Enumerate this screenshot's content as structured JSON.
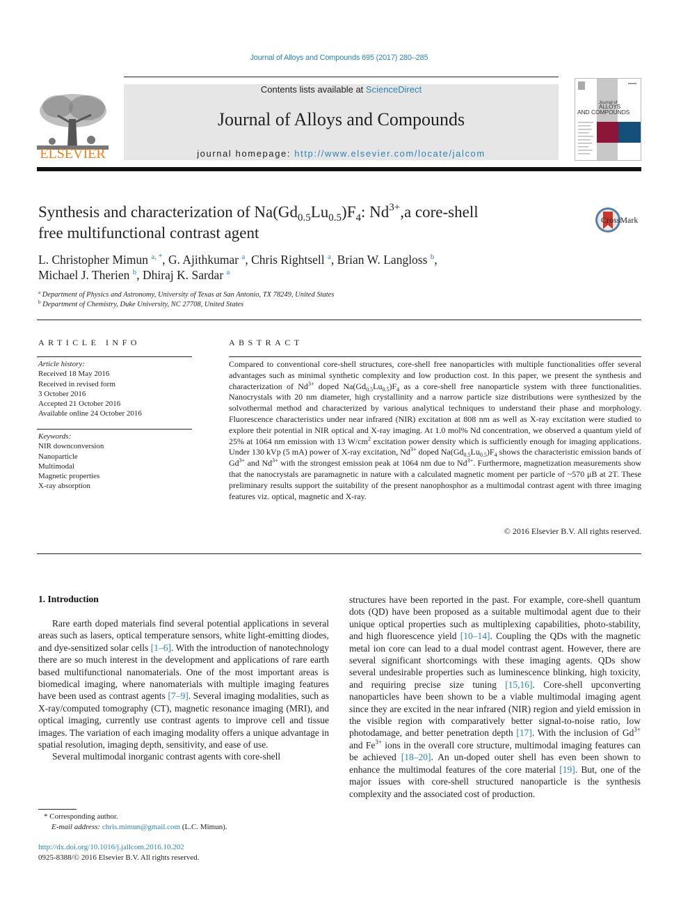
{
  "header": {
    "citation": "Journal of Alloys and Compounds 695 (2017) 280–285",
    "contents_prefix": "Contents lists available at ",
    "contents_link": "ScienceDirect",
    "journal_name": "Journal of Alloys and Compounds",
    "homepage_prefix": "journal homepage: ",
    "homepage_url": "http://www.elsevier.com/locate/jalcom",
    "publisher_logo_text": "ELSEVIER",
    "cover": {
      "title_line1": "Journal of",
      "title_line2": "ALLOYS",
      "title_line3": "AND COMPOUNDS",
      "accent_colors": [
        "#8c1538",
        "#15507a",
        "#c8c8c8"
      ]
    },
    "crossmark_label": "CrossMark"
  },
  "article": {
    "title_parts": {
      "p1": "Synthesis and characterization of Na(Gd",
      "s1": "0.5",
      "p2": "Lu",
      "s2": "0.5",
      "p3": ")F",
      "s3": "4",
      "p4": ": Nd",
      "sup1": "3+",
      "p5": ",a core-shell",
      "line2": "free multifunctional contrast agent"
    },
    "authors": [
      {
        "name": "L. Christopher Mimun",
        "aff": "a, *"
      },
      {
        "name": "G. Ajithkumar",
        "aff": "a"
      },
      {
        "name": "Chris Rightsell",
        "aff": "a"
      },
      {
        "name": "Brian W. Langloss",
        "aff": "b"
      },
      {
        "name": "Michael J. Therien",
        "aff": "b"
      },
      {
        "name": "Dhiraj K. Sardar",
        "aff": "a"
      }
    ],
    "affiliations": [
      {
        "key": "a",
        "text": "Department of Physics and Astronomy, University of Texas at San Antonio, TX 78249, United States"
      },
      {
        "key": "b",
        "text": "Department of Chemistry, Duke University, NC 27708, United States"
      }
    ]
  },
  "article_info": {
    "heading": "ARTICLE INFO",
    "history_heading": "Article history:",
    "history": [
      "Received 18 May 2016",
      "Received in revised form",
      "3 October 2016",
      "Accepted 21 October 2016",
      "Available online 24 October 2016"
    ],
    "keywords_heading": "Keywords:",
    "keywords": [
      "NIR downconversion",
      "Nanoparticle",
      "Multimodal",
      "Magnetic properties",
      "X-ray absorption"
    ]
  },
  "abstract": {
    "heading": "ABSTRACT",
    "t1": "Compared to conventional core-shell structures, core-shell free nanoparticles with multiple functionalities offer several advantages such as minimal synthetic complexity and low production cost. In this paper, we present the synthesis and characterization of Nd",
    "t2": " doped Na(Gd",
    "t3": "Lu",
    "t4": ")F",
    "t5": " as a core-shell free nanoparticle system with three functionalities. Nanocrystals with 20 nm diameter, high crystallinity and a narrow particle size distributions were synthesized by the solvothermal method and characterized by various analytical techniques to understand their phase and morphology. Fluorescence characteristics under near infrared (NIR) excitation at 808 nm as well as X-ray excitation were studied to explore their potential in NIR optical and X-ray imaging. At 1.0 mol% Nd concentration, we observed a quantum yield of 25% at 1064 nm emission with 13 W/cm",
    "t6": " excitation power density which is sufficiently enough for imaging applications. Under 130 kVp (5 mA) power of X-ray excitation, Nd",
    "t7": " doped Na(Gd",
    "t8": "Lu",
    "t9": ")F",
    "t10": " shows the characteristic emission bands of Gd",
    "t11": " and Nd",
    "t12": " with the strongest emission peak at 1064 nm due to Nd",
    "t13": ". Furthermore, magnetization measurements show that the nanocrystals are paramagnetic in nature with a calculated magnetic moment per particle of ~570 μB at 2T. These preliminary results support the suitability of the present nanophosphor as a multimodal contrast agent with three imaging features viz. optical, magnetic and X-ray.",
    "sup_3plus": "3+",
    "sub_05": "0.5",
    "sub_4": "4",
    "sup_2": "2",
    "copyright": "© 2016 Elsevier B.V. All rights reserved."
  },
  "introduction": {
    "heading": "1.  Introduction",
    "left_p1_a": "Rare earth doped materials find several potential applications in several areas such as lasers, optical temperature sensors, white light-emitting diodes, and dye-sensitized solar cells ",
    "left_p1_ref1": "[1–6]",
    "left_p1_b": ". With the introduction of nanotechnology there are so much interest in the development and applications of rare earth based multifunctional nanomaterials. One of the most important areas is biomedical imaging, where nanomaterials with multiple imaging features have been used as contrast agents ",
    "left_p1_ref2": "[7–9]",
    "left_p1_c": ". Several imaging modalities, such as X-ray/computed tomography (CT), magnetic resonance imaging (MRI), and optical imaging, currently use contrast agents to improve cell and tissue images. The variation of each imaging modality offers a unique advantage in spatial resolution, imaging depth, sensitivity, and ease of use.",
    "left_p2": "Several multimodal inorganic contrast agents with core-shell",
    "right_a": "structures have been reported in the past. For example, core-shell quantum dots (QD) have been proposed as a suitable multimodal agent due to their unique optical properties such as multiplexing capabilities, photo-stability, and high fluorescence yield ",
    "right_ref1": "[10–14]",
    "right_b": ". Coupling the QDs with the magnetic metal ion core can lead to a dual model contrast agent. However, there are several significant shortcomings with these imaging agents. QDs show several undesirable properties such as luminescence blinking, high toxicity, and requiring precise size tuning ",
    "right_ref2": "[15,16]",
    "right_c": ". Core-shell upconverting nanoparticles have been shown to be a viable multimodal imaging agent since they are excited in the near infrared (NIR) region and yield emission in the visible region with comparatively better signal-to-noise ratio, low photodamage, and better penetration depth ",
    "right_ref3": "[17]",
    "right_d": ". With the inclusion of Gd",
    "right_sup": "3+",
    "right_e": " and Fe",
    "right_f": " ions in the overall core structure, multimodal imaging features can be achieved ",
    "right_ref4": "[18–20]",
    "right_g": ". An un-doped outer shell has even been shown to enhance the multimodal features of the core material ",
    "right_ref5": "[19]",
    "right_h": ". But, one of the major issues with core-shell structured nanoparticle is the synthesis complexity and the associated cost of production."
  },
  "footer": {
    "corresponding": "* Corresponding author.",
    "email_label": "E-mail address: ",
    "email": "chris.mimun@gmail.com",
    "email_suffix": " (L.C. Mimun).",
    "doi": "http://dx.doi.org/10.1016/j.jallcom.2016.10.202",
    "issn": "0925-8388/© 2016 Elsevier B.V. All rights reserved."
  }
}
